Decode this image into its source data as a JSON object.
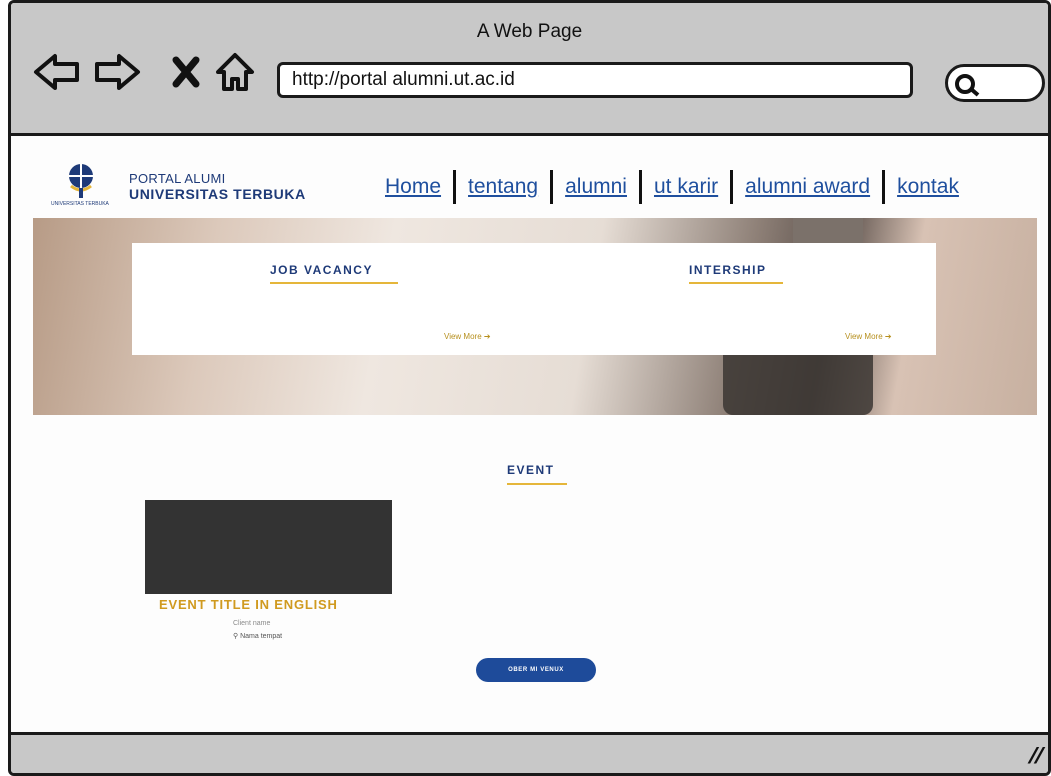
{
  "window": {
    "title": "A Web Page"
  },
  "browser": {
    "url": "http://portal alumni.ut.ac.id",
    "icons": [
      "back-arrow-icon",
      "forward-arrow-icon",
      "close-x-icon",
      "home-icon",
      "search-icon"
    ]
  },
  "site": {
    "brand": {
      "line1": "PORTAL ALUMI",
      "line2": "UNIVERSITAS TERBUKA",
      "logo_caption": "UNIVERSITAS TERBUKA"
    },
    "nav": [
      {
        "label": "Home"
      },
      {
        "label": "tentang"
      },
      {
        "label": "alumni"
      },
      {
        "label": "ut karir"
      },
      {
        "label": "alumni award"
      },
      {
        "label": "kontak"
      }
    ],
    "cards": [
      {
        "title": "JOB VACANCY",
        "link": "View More ➔"
      },
      {
        "title": "INTERSHIP",
        "link": "View More ➔"
      }
    ],
    "event": {
      "heading": "EVENT",
      "item": {
        "title": "EVENT TITLE IN ENGLISH",
        "date": "Client name",
        "location": "Nama tempat"
      },
      "button": "OBER MI VENUX"
    }
  },
  "colors": {
    "brand_blue": "#1e3a78",
    "link_blue": "#1f4f9e",
    "accent_gold": "#e5b63a",
    "chrome_gray": "#c8c8c8"
  }
}
